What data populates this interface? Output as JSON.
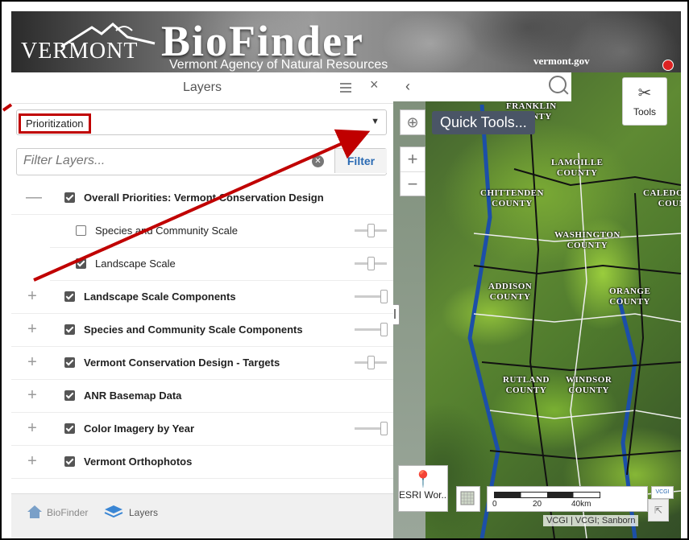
{
  "header": {
    "state_word": "VERMONT",
    "app_title": "BioFinder",
    "agency": "Vermont Agency of Natural Resources",
    "site_link": "vermont.gov"
  },
  "panel": {
    "title": "Layers",
    "dropdown_value": "Prioritization",
    "filter_placeholder": "Filter Layers...",
    "filter_button": "Filter"
  },
  "layers": [
    {
      "label": "Overall Priorities: Vermont Conservation Design",
      "checked": true,
      "bold": true,
      "expanded": true,
      "slider_pos": null
    },
    {
      "label": "Species and Community Scale",
      "checked": false,
      "bold": false,
      "child": true,
      "slider_pos": 0.55
    },
    {
      "label": "Landscape Scale",
      "checked": true,
      "bold": false,
      "child": true,
      "slider_pos": 0.55
    },
    {
      "label": "Landscape Scale Components",
      "checked": true,
      "bold": true,
      "expanded": false,
      "slider_pos": 0.95
    },
    {
      "label": "Species and Community Scale Components",
      "checked": true,
      "bold": true,
      "expanded": false,
      "slider_pos": 0.95
    },
    {
      "label": "Vermont Conservation Design - Targets",
      "checked": true,
      "bold": true,
      "expanded": false,
      "slider_pos": 0.55
    },
    {
      "label": "ANR Basemap Data",
      "checked": true,
      "bold": true,
      "expanded": false,
      "slider_pos": null
    },
    {
      "label": "Color Imagery by Year",
      "checked": true,
      "bold": true,
      "expanded": false,
      "slider_pos": 0.95
    },
    {
      "label": "Vermont Orthophotos",
      "checked": true,
      "bold": true,
      "expanded": false,
      "slider_pos": null
    }
  ],
  "tabs": {
    "biofinder": "BioFinder",
    "layers": "Layers"
  },
  "map": {
    "quick_tools": "Quick Tools...",
    "tools_label": "Tools",
    "basemap_label": "ESRI Wor...",
    "scale_0": "0",
    "scale_20": "20",
    "scale_40": "40km",
    "attribution": "VCGI | VCGI; Sanborn",
    "counties": [
      {
        "name": "FRANKLIN",
        "sub": "COUNTY"
      },
      {
        "name": "LAMOILLE",
        "sub": "COUNTY"
      },
      {
        "name": "CHITTENDEN",
        "sub": "COUNTY"
      },
      {
        "name": "CALEDONIA",
        "sub": "COUN"
      },
      {
        "name": "WASHINGTON",
        "sub": "COUNTY"
      },
      {
        "name": "ADDISON",
        "sub": "COUNTY"
      },
      {
        "name": "ORANGE",
        "sub": "COUNTY"
      },
      {
        "name": "RUTLAND",
        "sub": "COUNTY"
      },
      {
        "name": "WINDSOR",
        "sub": "COUNTY"
      }
    ]
  },
  "colors": {
    "annotation_red": "#c00000",
    "filter_blue": "#2a6ab3",
    "quick_tools_bg": "#4a5566"
  }
}
